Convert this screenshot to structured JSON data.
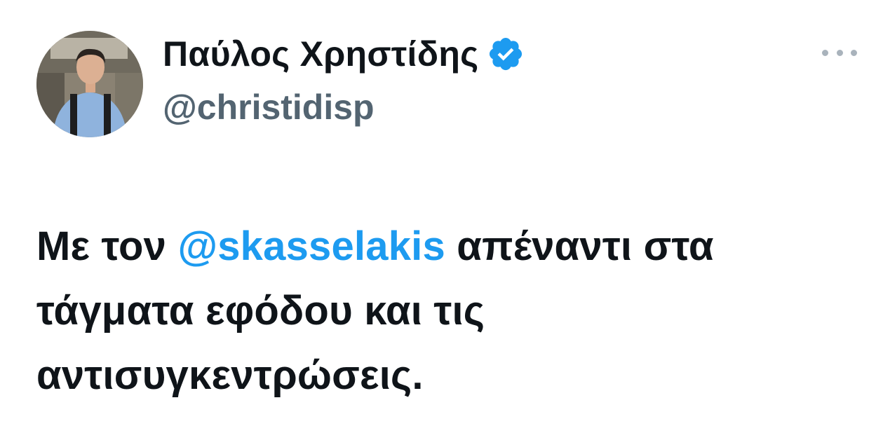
{
  "author": {
    "display_name": "Παύλος Χρηστίδης",
    "handle": "@christidisp",
    "verified": true,
    "verified_color": "#1d9bf0"
  },
  "menu": {
    "icon": "more-horizontal-icon"
  },
  "tweet": {
    "line1_before": "Με τον ",
    "mention": "@skasselakis",
    "line1_after": " απέναντι στα",
    "line2": "τάγματα εφόδου και τις",
    "line3": "αντισυγκεντρώσεις."
  },
  "colors": {
    "text": "#0f1419",
    "secondary": "#536471",
    "accent": "#1d9bf0"
  }
}
